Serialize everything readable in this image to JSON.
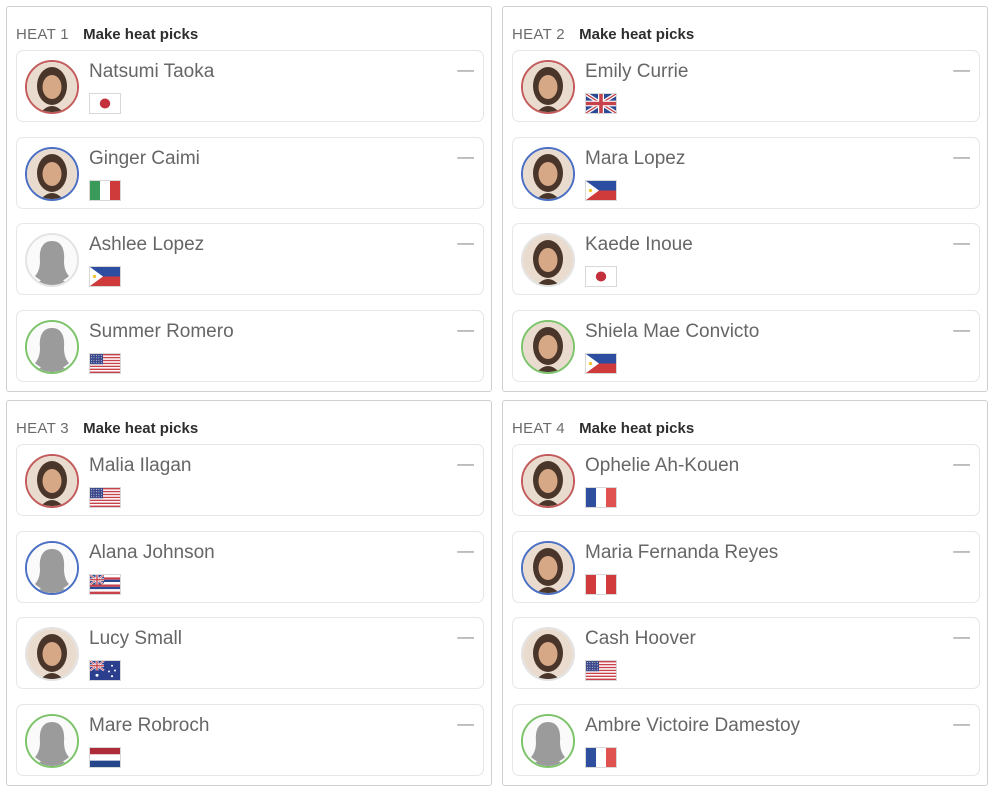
{
  "colors": {
    "jersey_red": "#c45b5b",
    "jersey_blue": "#4a6fc4",
    "jersey_white": "#e3e3e3",
    "jersey_green": "#7cc46a"
  },
  "heats": [
    {
      "label": "HEAT 1",
      "action": "Make heat picks",
      "athletes": [
        {
          "name": "Natsumi Taoka",
          "score": "––",
          "jersey": "red",
          "photo": "photo",
          "flag": "japan-flag-icon"
        },
        {
          "name": "Ginger Caimi",
          "score": "––",
          "jersey": "blue",
          "photo": "photo",
          "flag": "italy-flag-icon"
        },
        {
          "name": "Ashlee Lopez",
          "score": "––",
          "jersey": "white",
          "photo": "placeholder",
          "flag": "philippines-flag-icon"
        },
        {
          "name": "Summer Romero",
          "score": "––",
          "jersey": "green",
          "photo": "placeholder",
          "flag": "usa-flag-icon"
        }
      ]
    },
    {
      "label": "HEAT 2",
      "action": "Make heat picks",
      "athletes": [
        {
          "name": "Emily Currie",
          "score": "––",
          "jersey": "red",
          "photo": "photo",
          "flag": "uk-flag-icon"
        },
        {
          "name": "Mara Lopez",
          "score": "––",
          "jersey": "blue",
          "photo": "photo",
          "flag": "philippines-flag-icon"
        },
        {
          "name": "Kaede Inoue",
          "score": "––",
          "jersey": "white",
          "photo": "photo",
          "flag": "japan-flag-icon"
        },
        {
          "name": "Shiela Mae Convicto",
          "score": "––",
          "jersey": "green",
          "photo": "photo",
          "flag": "philippines-flag-icon"
        }
      ]
    },
    {
      "label": "HEAT 3",
      "action": "Make heat picks",
      "athletes": [
        {
          "name": "Malia Ilagan",
          "score": "––",
          "jersey": "red",
          "photo": "photo",
          "flag": "usa-flag-icon"
        },
        {
          "name": "Alana Johnson",
          "score": "––",
          "jersey": "blue",
          "photo": "placeholder",
          "flag": "hawaii-flag-icon"
        },
        {
          "name": "Lucy Small",
          "score": "––",
          "jersey": "white",
          "photo": "photo",
          "flag": "australia-flag-icon"
        },
        {
          "name": "Mare Robroch",
          "score": "––",
          "jersey": "green",
          "photo": "placeholder",
          "flag": "netherlands-flag-icon"
        }
      ]
    },
    {
      "label": "HEAT 4",
      "action": "Make heat picks",
      "athletes": [
        {
          "name": "Ophelie Ah-Kouen",
          "score": "––",
          "jersey": "red",
          "photo": "photo",
          "flag": "france-flag-icon"
        },
        {
          "name": "Maria Fernanda Reyes",
          "score": "––",
          "jersey": "blue",
          "photo": "photo",
          "flag": "peru-flag-icon"
        },
        {
          "name": "Cash Hoover",
          "score": "––",
          "jersey": "white",
          "photo": "photo",
          "flag": "usa-flag-icon"
        },
        {
          "name": "Ambre Victoire Damestoy",
          "score": "––",
          "jersey": "green",
          "photo": "placeholder",
          "flag": "france-flag-icon"
        }
      ]
    }
  ]
}
